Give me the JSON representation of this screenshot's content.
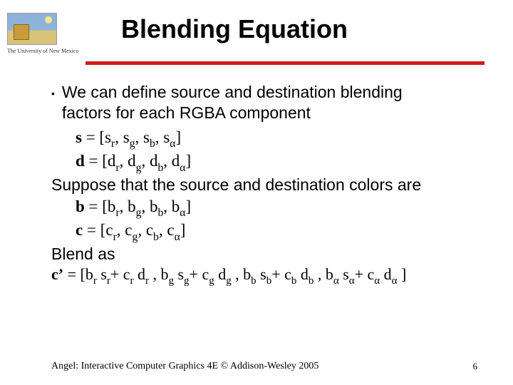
{
  "logo": {
    "university": "The University of New Mexico"
  },
  "title": "Blending Equation",
  "body": {
    "bullet1_l1": "We can define source and destination blending",
    "bullet1_l2": "factors for each RGBA component",
    "s_eq_prefix": "s",
    "s_eq_rest": " = [s",
    "d_eq_prefix": "d",
    "d_eq_rest": " = [d",
    "sub_r": "r",
    "sub_g": "g",
    "sub_b": "b",
    "sub_a": "α",
    "comma": ", ",
    "close": "]",
    "suppose": "Suppose that the source and destination colors are",
    "b_eq_prefix": "b",
    "b_eq_rest": " = [b",
    "c_eq_prefix": "c",
    "c_eq_rest": " = [c",
    "blendas": "Blend as",
    "cprime_prefix": "c’",
    "cprime_rest": " = [b",
    "sp": " s",
    "plus_c": "+ c",
    "dp": " d",
    "comma_b": " , b",
    "comma_bb": " , b",
    "plus_cb": "+ c",
    "sp2": " s",
    "dp2": " d",
    "end": " ]"
  },
  "footer": {
    "credit": "Angel: Interactive Computer Graphics 4E © Addison-Wesley 2005",
    "page": "6"
  }
}
